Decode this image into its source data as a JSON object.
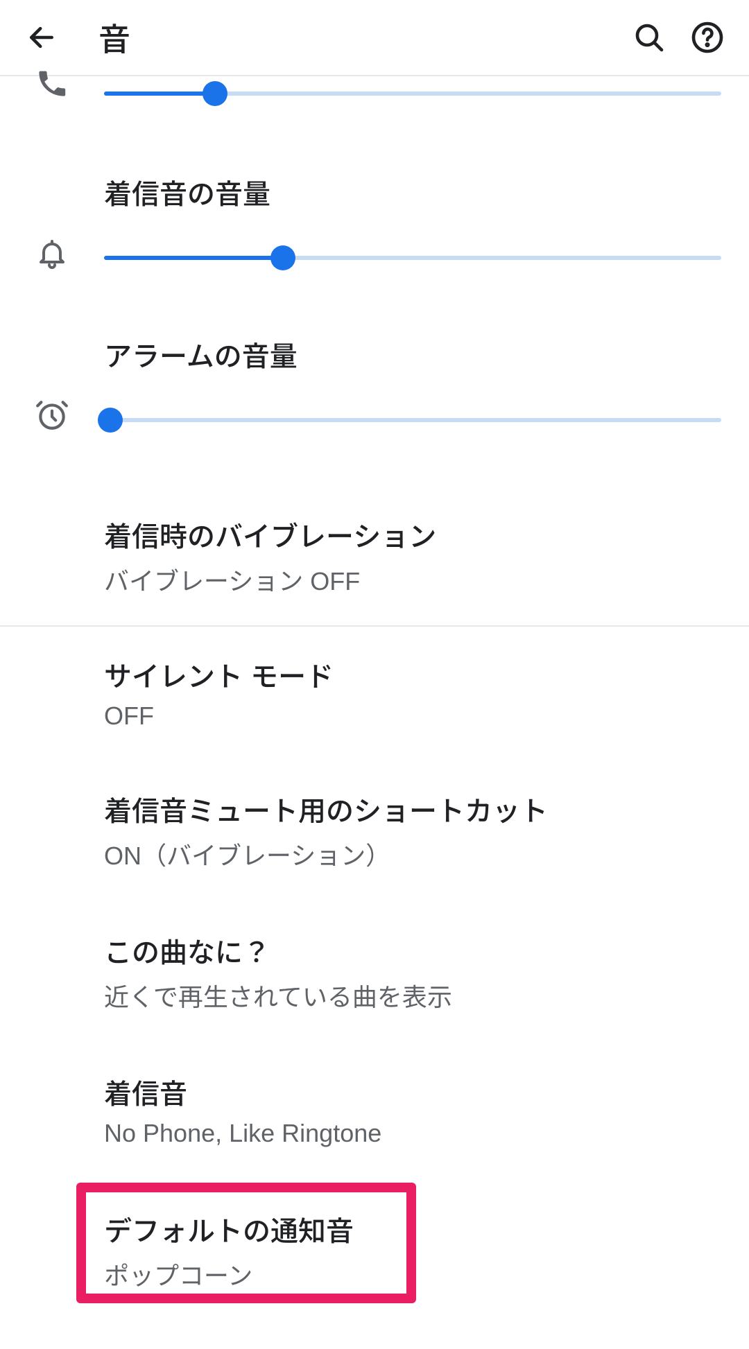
{
  "colors": {
    "accent": "#1a73e8",
    "sliderTrack": "#c7dbf7",
    "icon": "#5f6368",
    "highlight": "#e91e63"
  },
  "header": {
    "title": "音"
  },
  "sliders": {
    "call": {
      "label": "",
      "pct": 18,
      "icon": "phone"
    },
    "ring": {
      "label": "着信音の音量",
      "pct": 29,
      "icon": "bell"
    },
    "alarm": {
      "label": "アラームの音量",
      "pct": 1,
      "icon": "alarm"
    }
  },
  "items": {
    "vibration": {
      "title": "着信時のバイブレーション",
      "subtitle": "バイブレーション OFF"
    },
    "silent": {
      "title": "サイレント モード",
      "subtitle": "OFF"
    },
    "shortcut": {
      "title": "着信音ミュート用のショートカット",
      "subtitle": "ON（バイブレーション）"
    },
    "nowplay": {
      "title": "この曲なに？",
      "subtitle": "近くで再生されている曲を表示"
    },
    "ringtone": {
      "title": "着信音",
      "subtitle": "No Phone, Like Ringtone"
    },
    "notif": {
      "title": "デフォルトの通知音",
      "subtitle": "ポップコーン"
    }
  }
}
